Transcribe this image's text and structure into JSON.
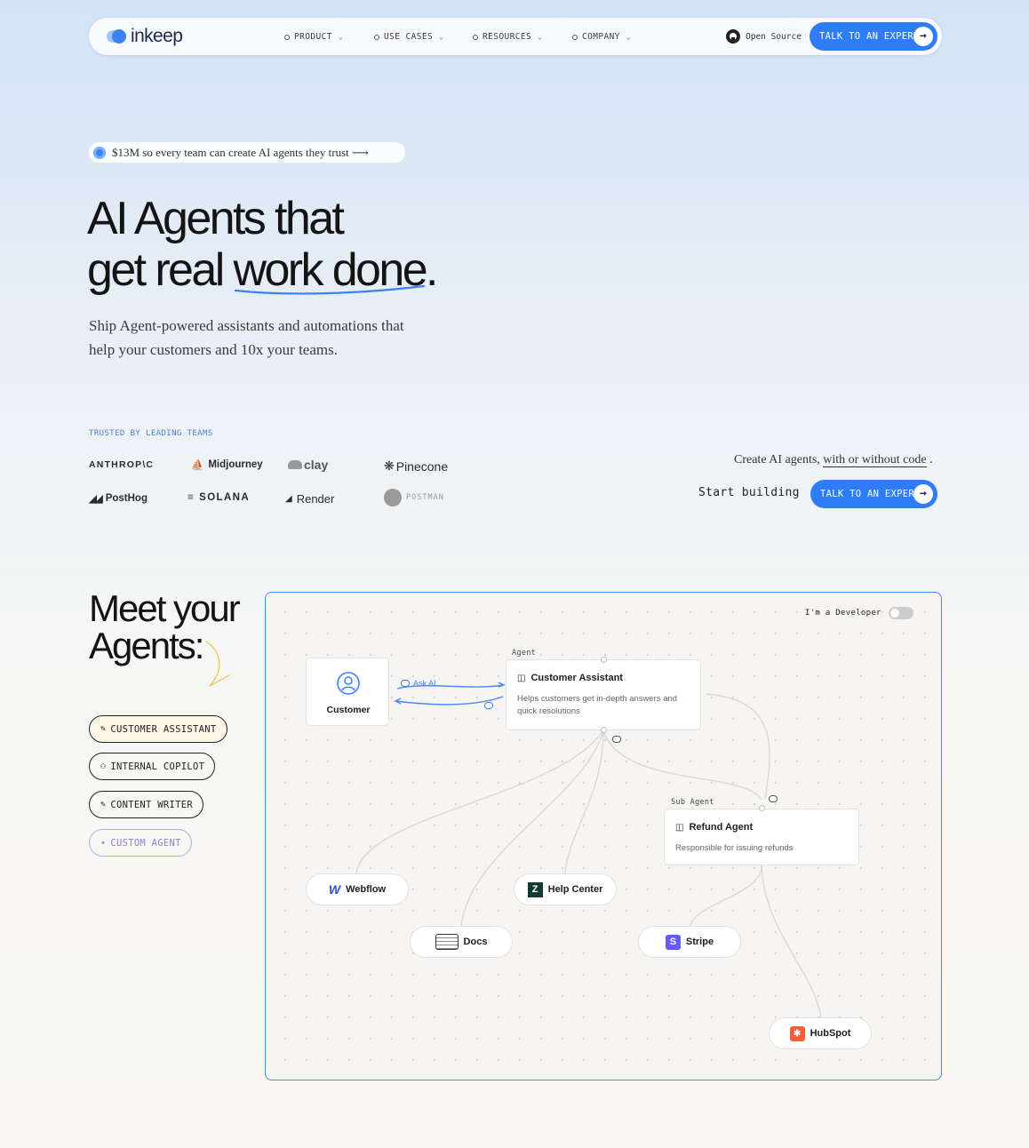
{
  "nav": {
    "logo_text": "inkeep",
    "menu": [
      "PRODUCT",
      "USE CASES",
      "RESOURCES",
      "COMPANY"
    ],
    "open_source": "Open Source",
    "cta": "TALK TO AN EXPERT"
  },
  "hero": {
    "pill": "$13M so every team can create AI agents they trust ⟶",
    "title_line1": "AI Agents that",
    "title_line2a": "get real ",
    "title_line2b": "work done",
    "title_period": ".",
    "subtitle": "Ship Agent-powered assistants and automations that help your customers and 10x your teams."
  },
  "trusted": {
    "label": "TRUSTED BY LEADING TEAMS",
    "brands": [
      "ANTHROP\\C",
      "Midjourney",
      "clay",
      "Pinecone",
      "PostHog",
      "SOLANA",
      "Render",
      "POSTMAN"
    ]
  },
  "create": {
    "prefix": "Create AI agents, ",
    "link": "with or without code",
    "suffix": " .",
    "start": "Start building",
    "cta": "TALK TO AN EXPERT"
  },
  "meet": {
    "title_line1": "Meet your",
    "title_line2": "Agents:",
    "agents": [
      "CUSTOMER ASSISTANT",
      "INTERNAL COPILOT",
      "CONTENT WRITER",
      "CUSTOM AGENT"
    ]
  },
  "canvas": {
    "dev_toggle": "I'm a Developer",
    "customer": "Customer",
    "ask_ai": "Ask AI",
    "agent_tag": "Agent",
    "agent_title": "Customer Assistant",
    "agent_desc": "Helps customers get in-depth answers and quick resolutions",
    "sub_tag": "Sub Agent",
    "sub_title": "Refund Agent",
    "sub_desc": "Responsible for issuing refunds",
    "tools": [
      "Webflow",
      "Help Center",
      "Docs",
      "Stripe",
      "HubSpot"
    ]
  },
  "colors": {
    "accent": "#2f7df6",
    "canvas_border": "#4a8bf0",
    "customer_assistant_bg": "#fdf6e6",
    "custom_agent": "#8a7fd6"
  }
}
